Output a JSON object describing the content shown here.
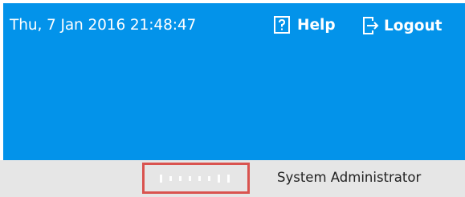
{
  "header": {
    "datetime": "Thu, 7 Jan 2016 21:48:47",
    "help_label": "Help",
    "help_icon": "help-icon",
    "logout_label": "Logout",
    "logout_icon": "logout-icon",
    "background_color": "#0393ea"
  },
  "user_bar": {
    "logo_icon": "user-logo-icon",
    "user_name": "System Administrator",
    "highlight_color": "#d9534f",
    "background_color": "#e6e6e6"
  }
}
